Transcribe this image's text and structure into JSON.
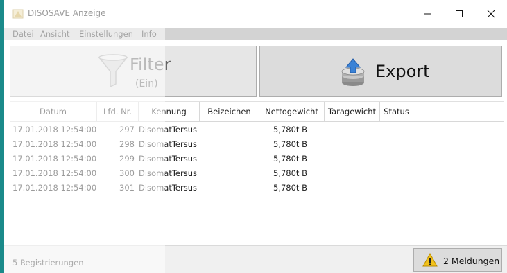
{
  "window": {
    "title": "DISOSAVE Anzeige",
    "minimize_glyph": "—",
    "close_glyph": "✕"
  },
  "menu": [
    {
      "label": "Datei"
    },
    {
      "label": "Ansicht"
    },
    {
      "label": "Einstellungen"
    },
    {
      "label": "Info"
    }
  ],
  "toolbar": {
    "filter": {
      "label": "Filter",
      "sublabel": "(Ein)",
      "icon": "funnel-icon"
    },
    "export": {
      "label": "Export",
      "icon": "database-upload-icon"
    }
  },
  "table": {
    "columns": [
      "Datum",
      "Lfd. Nr.",
      "Kennung",
      "Beizeichen",
      "Nettogewicht",
      "Taragewicht",
      "Status"
    ],
    "rows": [
      {
        "datum": "17.01.2018 12:54:00",
        "nr": "297",
        "kennung": "DisomatTersus",
        "beizeichen": "",
        "netto": "5,780t B",
        "tara": "",
        "status": ""
      },
      {
        "datum": "17.01.2018 12:54:00",
        "nr": "298",
        "kennung": "DisomatTersus",
        "beizeichen": "",
        "netto": "5,780t B",
        "tara": "",
        "status": ""
      },
      {
        "datum": "17.01.2018 12:54:00",
        "nr": "299",
        "kennung": "DisomatTersus",
        "beizeichen": "",
        "netto": "5,780t B",
        "tara": "",
        "status": ""
      },
      {
        "datum": "17.01.2018 12:54:00",
        "nr": "300",
        "kennung": "DisomatTersus",
        "beizeichen": "",
        "netto": "5,780t B",
        "tara": "",
        "status": ""
      },
      {
        "datum": "17.01.2018 12:54:00",
        "nr": "301",
        "kennung": "DisomatTersus",
        "beizeichen": "",
        "netto": "5,780t B",
        "tara": "",
        "status": ""
      }
    ]
  },
  "status": {
    "registrations": "5 Registrierungen",
    "messages_label": "2 Meldungen",
    "messages_icon": "warning-icon"
  },
  "colors": {
    "desktop": "#1a8a8a",
    "menubar": "#d3d3d3",
    "button_face": "#dcdcdc",
    "warning": "#f2c21b"
  }
}
